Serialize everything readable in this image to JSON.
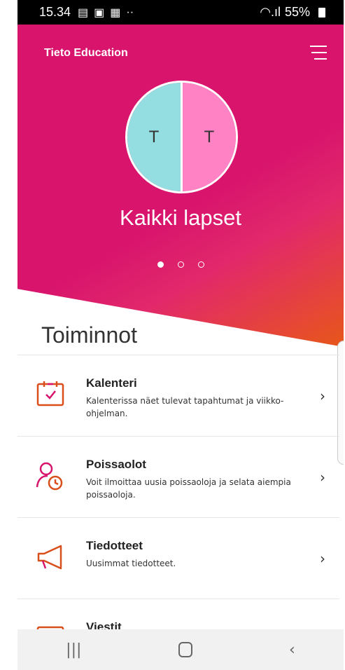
{
  "status": {
    "time": "15.34",
    "icons": [
      "mail-icon",
      "gallery-icon",
      "teams-icon",
      "more-icon"
    ],
    "right": {
      "signal": "wifi-signal-icon",
      "battery": "55%"
    }
  },
  "header": {
    "brand": "Tieto Education",
    "menu_icon": "menu-icon"
  },
  "hero": {
    "avatar_left": "T",
    "avatar_right": "T",
    "title": "Kaikki lapset",
    "pages": 3,
    "active_page": 1,
    "colors": {
      "primary": "#d8146c",
      "accent": "#e7571a",
      "avatar_left": "#94dde0",
      "avatar_right": "#ff82c4"
    }
  },
  "section_title": "Toiminnot",
  "items": [
    {
      "title": "Kalenteri",
      "desc": "Kalenterissa näet tulevat tapahtumat ja viikko-ohjelman.",
      "icon": "calendar-icon"
    },
    {
      "title": "Poissaolot",
      "desc": "Voit ilmoittaa uusia poissaoloja ja selata aiempia poissaoloja.",
      "icon": "person-clock-icon"
    },
    {
      "title": "Tiedotteet",
      "desc": "Uusimmat tiedotteet.",
      "icon": "megaphone-icon"
    },
    {
      "title": "Viestit",
      "desc": "",
      "icon": "message-icon"
    }
  ],
  "nav": {
    "recent": "|||",
    "back": "‹"
  }
}
